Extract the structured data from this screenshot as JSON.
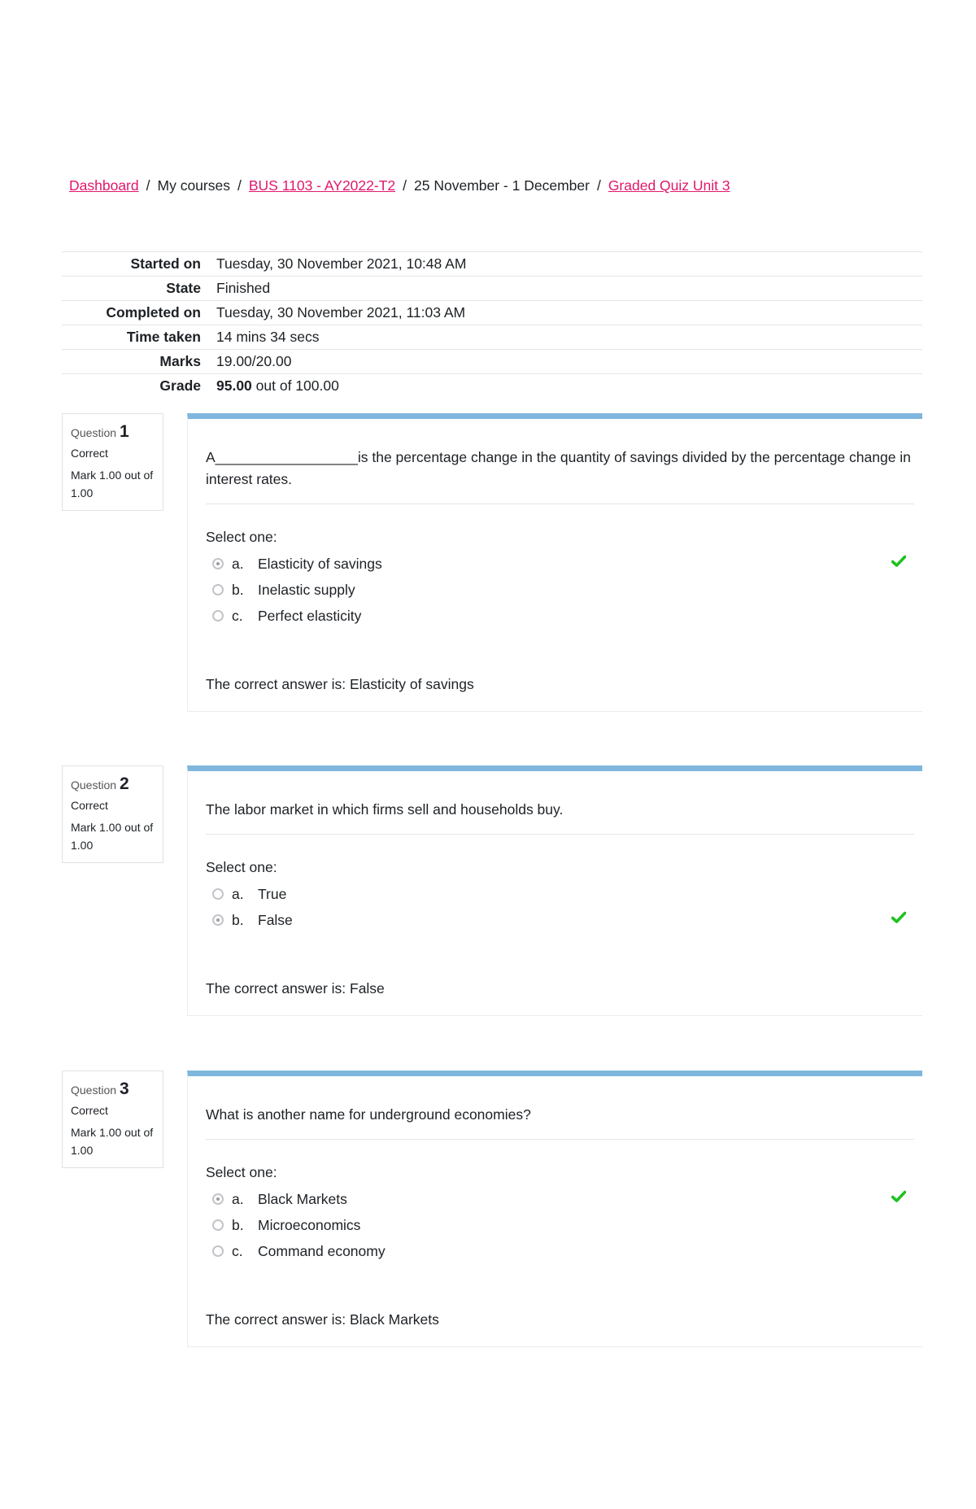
{
  "breadcrumb": {
    "items": [
      {
        "label": "Dashboard",
        "link": true
      },
      {
        "label": "My courses",
        "link": false
      },
      {
        "label": "BUS 1103 - AY2022-T2",
        "link": true
      },
      {
        "label": "25 November - 1 December",
        "link": false
      },
      {
        "label": "Graded Quiz Unit 3",
        "link": true
      }
    ],
    "separator": "/"
  },
  "summary": {
    "rows": [
      {
        "label": "Started on",
        "value": "Tuesday, 30 November 2021, 10:48 AM"
      },
      {
        "label": "State",
        "value": "Finished"
      },
      {
        "label": "Completed on",
        "value": "Tuesday, 30 November 2021, 11:03 AM"
      },
      {
        "label": "Time taken",
        "value": "14 mins 34 secs"
      },
      {
        "label": "Marks",
        "value": "19.00/20.00"
      },
      {
        "label": "Grade",
        "value_bold": "95.00",
        "value_rest": " out of 100.00"
      }
    ]
  },
  "colors": {
    "link": "#e0186c",
    "question_bar": "#7fb6dd",
    "correct_check": "#1fc21f"
  },
  "questions": [
    {
      "prefix": "Question",
      "number": "1",
      "state": "Correct",
      "grade": "Mark 1.00 out of 1.00",
      "text": "A__________________is the percentage change in the quantity of savings divided by the percentage change in interest rates.",
      "select_label": "Select one:",
      "options": [
        {
          "letter": "a.",
          "label": "Elasticity of savings",
          "checked": true,
          "correct_icon": true
        },
        {
          "letter": "b.",
          "label": "Inelastic supply",
          "checked": false,
          "correct_icon": false
        },
        {
          "letter": "c.",
          "label": "Perfect elasticity",
          "checked": false,
          "correct_icon": false
        }
      ],
      "feedback": "The correct answer is: Elasticity of savings"
    },
    {
      "prefix": "Question",
      "number": "2",
      "state": "Correct",
      "grade": "Mark 1.00 out of 1.00",
      "text": "The labor market in which firms sell and households buy.",
      "select_label": "Select one:",
      "options": [
        {
          "letter": "a.",
          "label": "True",
          "checked": false,
          "correct_icon": false
        },
        {
          "letter": "b.",
          "label": "False",
          "checked": true,
          "correct_icon": true
        }
      ],
      "feedback": "The correct answer is: False"
    },
    {
      "prefix": "Question",
      "number": "3",
      "state": "Correct",
      "grade": "Mark 1.00 out of 1.00",
      "text": "What is another name for underground economies?",
      "select_label": "Select one:",
      "options": [
        {
          "letter": "a.",
          "label": "Black Markets",
          "checked": true,
          "correct_icon": true
        },
        {
          "letter": "b.",
          "label": "Microeconomics",
          "checked": false,
          "correct_icon": false
        },
        {
          "letter": "c.",
          "label": "Command economy",
          "checked": false,
          "correct_icon": false
        }
      ],
      "feedback": "The correct answer is: Black Markets"
    }
  ]
}
